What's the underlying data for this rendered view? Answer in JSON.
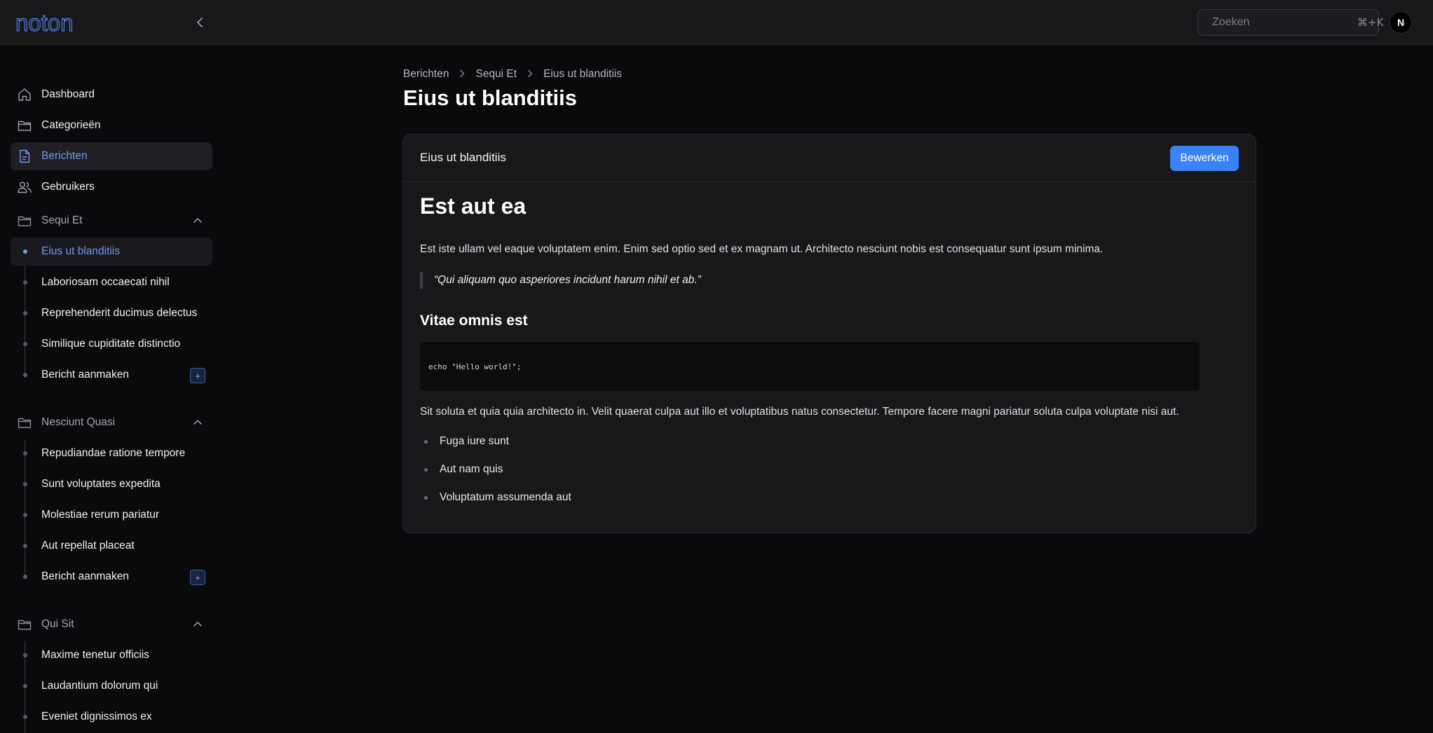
{
  "brand": {
    "logo_text": "noton"
  },
  "search": {
    "placeholder": "Zoeken",
    "shortcut": "⌘+K"
  },
  "user": {
    "avatar_initial": "N"
  },
  "sidebar": {
    "main_items": [
      {
        "label": "Dashboard",
        "icon": "home-icon"
      },
      {
        "label": "Categorieën",
        "icon": "folder-icon"
      },
      {
        "label": "Berichten",
        "icon": "document-icon",
        "active": true
      },
      {
        "label": "Gebruikers",
        "icon": "users-icon"
      }
    ],
    "groups": [
      {
        "label": "Sequi Et",
        "items": [
          "Eius ut blanditiis",
          "Laboriosam occaecati nihil",
          "Reprehenderit ducimus delectus",
          "Similique cupiditate distinctio"
        ],
        "create_label": "Bericht aanmaken"
      },
      {
        "label": "Nesciunt Quasi",
        "items": [
          "Repudiandae ratione tempore",
          "Sunt voluptates expedita",
          "Molestiae rerum pariatur",
          "Aut repellat placeat"
        ],
        "create_label": "Bericht aanmaken"
      },
      {
        "label": "Qui Sit",
        "items": [
          "Maxime tenetur officiis",
          "Laudantium dolorum qui",
          "Eveniet dignissimos ex"
        ]
      }
    ]
  },
  "breadcrumb": [
    "Berichten",
    "Sequi Et",
    "Eius ut blanditiis"
  ],
  "page_title": "Eius ut blanditiis",
  "card": {
    "title": "Eius ut blanditiis",
    "edit_label": "Bewerken",
    "heading1": "Est aut ea",
    "paragraph1": "Est iste ullam vel eaque voluptatem enim. Enim sed optio sed et ex magnam ut. Architecto nesciunt nobis est consequatur sunt ipsum minima.",
    "quote": "“Qui aliquam quo asperiores incidunt harum nihil et ab.”",
    "heading2": "Vitae omnis est",
    "code": "echo \"Hello world!\";",
    "paragraph2": "Sit soluta et quia quia architecto in. Velit quaerat culpa aut illo et voluptatibus natus consectetur. Tempore facere magni pariatur soluta culpa voluptate nisi aut.",
    "list": [
      "Fuga iure sunt",
      "Aut nam quis",
      "Voluptatum assumenda aut"
    ]
  },
  "colors": {
    "accent": "#3b82f6",
    "active_text": "#6f9cf2",
    "background": "#0a0a0c",
    "surface": "#18181b"
  }
}
